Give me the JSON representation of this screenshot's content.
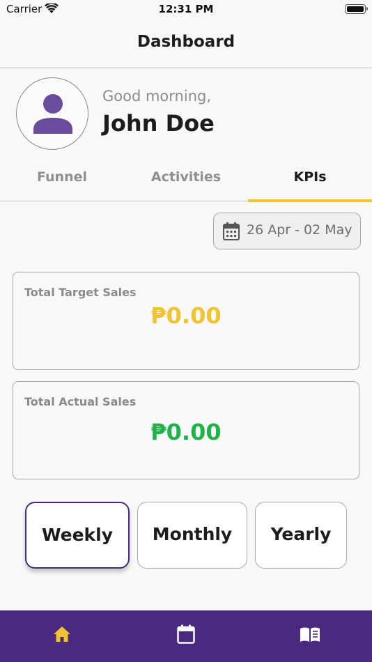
{
  "status_bar": {
    "carrier": "Carrier",
    "time": "12:31 PM"
  },
  "header": {
    "title": "Dashboard"
  },
  "profile": {
    "greeting": "Good morning,",
    "name": "John Doe",
    "avatar_icon": "person-icon"
  },
  "tabs": [
    {
      "label": "Funnel",
      "active": false
    },
    {
      "label": "Activities",
      "active": false
    },
    {
      "label": "KPIs",
      "active": true
    }
  ],
  "date_range": {
    "label": "26 Apr - 02 May",
    "icon": "calendar-icon"
  },
  "cards": {
    "target": {
      "label": "Total Target Sales",
      "value": "₱0.00",
      "color": "#f0c330"
    },
    "actual": {
      "label": "Total Actual Sales",
      "value": "₱0.00",
      "color": "#1fb34a"
    }
  },
  "periods": [
    {
      "label": "Weekly",
      "active": true
    },
    {
      "label": "Monthly",
      "active": false
    },
    {
      "label": "Yearly",
      "active": false
    }
  ],
  "bottom_tabs": [
    {
      "icon": "home-icon",
      "active": true
    },
    {
      "icon": "calendar-icon",
      "active": false
    },
    {
      "icon": "book-icon",
      "active": false
    }
  ],
  "colors": {
    "accent": "#f0c330",
    "brand": "#4a2a7e",
    "positive": "#1fb34a"
  }
}
